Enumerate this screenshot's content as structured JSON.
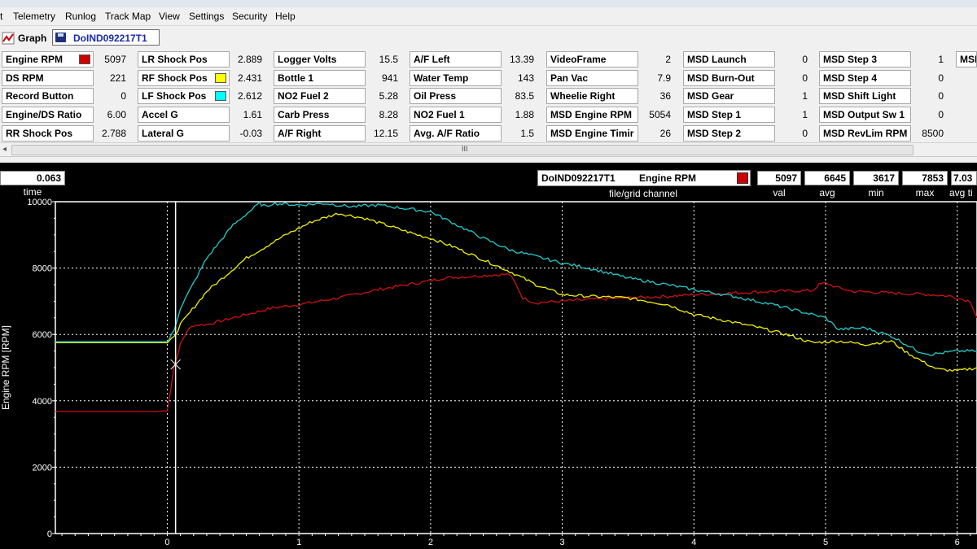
{
  "menu": [
    "t",
    "Telemetry",
    "Runlog",
    "Track Map",
    "View",
    "Settings",
    "Security",
    "Help"
  ],
  "tabs": {
    "graph_label": "Graph",
    "file_label": "DoIND092217T1"
  },
  "channels": [
    {
      "label": "Engine RPM",
      "value": "5097",
      "swatch": "#cc0000"
    },
    {
      "label": "DS RPM",
      "value": "221"
    },
    {
      "label": "Record Button",
      "value": "0"
    },
    {
      "label": "Engine/DS Ratio",
      "value": "6.00"
    },
    {
      "label": "RR Shock Pos",
      "value": "2.788"
    },
    {
      "label": "LR Shock Pos",
      "value": "2.889"
    },
    {
      "label": "RF Shock Pos",
      "value": "2.431",
      "swatch": "#ffff00"
    },
    {
      "label": "LF Shock Pos",
      "value": "2.612",
      "swatch": "#00ffff"
    },
    {
      "label": "Accel G",
      "value": "1.61"
    },
    {
      "label": "Lateral G",
      "value": "-0.03"
    },
    {
      "label": "Logger Volts",
      "value": "15.5"
    },
    {
      "label": "Bottle 1",
      "value": "941"
    },
    {
      "label": "NO2 Fuel 2",
      "value": "5.28"
    },
    {
      "label": "Carb Press",
      "value": "8.28"
    },
    {
      "label": "A/F Right",
      "value": "12.15"
    },
    {
      "label": "A/F Left",
      "value": "13.39"
    },
    {
      "label": "Water Temp",
      "value": "143"
    },
    {
      "label": "Oil Press",
      "value": "83.5"
    },
    {
      "label": "NO2 Fuel 1",
      "value": "1.88"
    },
    {
      "label": "Avg. A/F Ratio",
      "value": "1.5"
    },
    {
      "label": "VideoFrame",
      "value": "2"
    },
    {
      "label": "Pan Vac",
      "value": "7.9"
    },
    {
      "label": "Wheelie Right",
      "value": "36"
    },
    {
      "label": "MSD Engine RPM",
      "value": "5054"
    },
    {
      "label": "MSD Engine Timir",
      "value": "26"
    },
    {
      "label": "MSD Launch",
      "value": "0"
    },
    {
      "label": "MSD Burn-Out",
      "value": "0"
    },
    {
      "label": "MSD Gear",
      "value": "1"
    },
    {
      "label": "MSD Step 1",
      "value": "1"
    },
    {
      "label": "MSD Step 2",
      "value": "0"
    },
    {
      "label": "MSD Step 3",
      "value": "1"
    },
    {
      "label": "MSD Step 4",
      "value": "0"
    },
    {
      "label": "MSD Shift Light",
      "value": "0"
    },
    {
      "label": "MSD Output Sw 1",
      "value": "0"
    },
    {
      "label": "MSD RevLim RPM",
      "value": "8500"
    },
    {
      "label": "MSD",
      "value": ""
    }
  ],
  "scroll": {
    "left_arrow": "◂",
    "grip": "III"
  },
  "readout": {
    "time_value": "0.063",
    "time_label": "time",
    "file_name": "DoIND092217T1",
    "channel_name": "Engine RPM",
    "channel_color": "#cc0000",
    "file_grid_label": "file/grid channel",
    "stats": [
      {
        "label": "val",
        "value": "5097"
      },
      {
        "label": "avg",
        "value": "6645"
      },
      {
        "label": "min",
        "value": "3617"
      },
      {
        "label": "max",
        "value": "7853"
      },
      {
        "label": "avg ti",
        "value": "7.03"
      }
    ]
  },
  "chart_data": {
    "type": "line",
    "ylabel": "Engine RPM [RPM]",
    "xlabel": "",
    "xlim": [
      -0.85,
      6.15
    ],
    "ylim": [
      0,
      10000
    ],
    "x_ticks": [
      "0",
      "1",
      "2",
      "3",
      "4",
      "5",
      "6"
    ],
    "y_ticks": [
      "0",
      "2000",
      "4000",
      "6000",
      "8000",
      "10000"
    ],
    "grid": true,
    "cursor_x": 0.063,
    "series": [
      {
        "color": "#cc1111",
        "x": [
          -0.85,
          -0.1,
          0.0,
          0.02,
          0.05,
          0.1,
          0.15,
          0.2,
          0.3,
          0.5,
          0.8,
          1.0,
          1.3,
          1.6,
          1.9,
          2.1,
          2.3,
          2.5,
          2.6,
          2.65,
          2.7,
          2.8,
          2.9,
          3.2,
          3.5,
          3.8,
          4.0,
          4.3,
          4.6,
          4.9,
          4.95,
          5.0,
          5.1,
          5.2,
          5.5,
          5.8,
          5.95,
          6.0,
          6.1,
          6.15
        ],
        "y": [
          3680,
          3680,
          3700,
          4200,
          5000,
          5700,
          6100,
          6280,
          6300,
          6500,
          6800,
          6900,
          7100,
          7350,
          7550,
          7700,
          7750,
          7800,
          7810,
          7500,
          7100,
          6950,
          6980,
          7050,
          7100,
          7150,
          7200,
          7250,
          7300,
          7320,
          7500,
          7550,
          7400,
          7300,
          7250,
          7200,
          7150,
          7100,
          7000,
          6500
        ]
      },
      {
        "color": "#f0f000",
        "x": [
          -0.85,
          0.0,
          0.05,
          0.1,
          0.3,
          0.6,
          0.9,
          1.1,
          1.3,
          1.5,
          1.7,
          1.9,
          2.0,
          2.2,
          2.4,
          2.6,
          2.8,
          3.0,
          3.2,
          3.5,
          3.8,
          4.0,
          4.2,
          4.5,
          4.7,
          4.9,
          5.1,
          5.3,
          5.5,
          5.6,
          5.75,
          5.85,
          6.0,
          6.15
        ],
        "y": [
          5750,
          5750,
          5900,
          6300,
          7300,
          8300,
          9000,
          9400,
          9650,
          9500,
          9250,
          9000,
          8900,
          8600,
          8250,
          7900,
          7500,
          7200,
          7150,
          7100,
          6900,
          6600,
          6450,
          6200,
          6000,
          5750,
          5800,
          5700,
          5800,
          5500,
          5150,
          4950,
          4900,
          5000
        ]
      },
      {
        "color": "#22cccc",
        "x": [
          -0.85,
          0.0,
          0.05,
          0.1,
          0.3,
          0.5,
          0.7,
          0.75,
          0.8,
          1.0,
          1.2,
          1.4,
          1.6,
          1.8,
          2.0,
          2.2,
          2.4,
          2.6,
          2.8,
          3.0,
          3.2,
          3.5,
          3.8,
          4.0,
          4.3,
          4.6,
          4.8,
          5.0,
          5.1,
          5.3,
          5.5,
          5.7,
          5.8,
          6.0,
          6.15
        ],
        "y": [
          5780,
          5780,
          6100,
          6800,
          8300,
          9300,
          9950,
          9850,
          9950,
          9900,
          9950,
          9850,
          9900,
          9800,
          9700,
          9300,
          8900,
          8550,
          8350,
          8150,
          8000,
          7700,
          7500,
          7350,
          7150,
          6900,
          6700,
          6500,
          6150,
          6200,
          5950,
          5500,
          5400,
          5500,
          5500
        ]
      }
    ]
  }
}
